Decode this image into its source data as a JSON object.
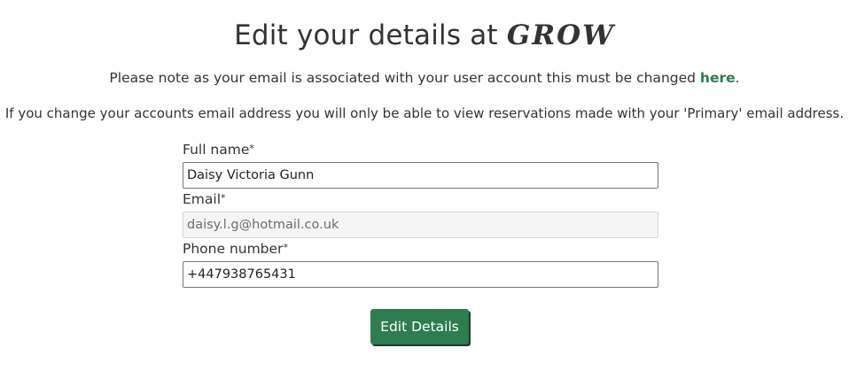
{
  "header": {
    "title_prefix": "Edit your details at",
    "brand": "GROW"
  },
  "notes": {
    "line1_prefix": "Please note as your email is associated with your user account this must be changed ",
    "line1_link": "here",
    "line1_suffix": ".",
    "line2": "If you change your accounts email address you will only be able to view reservations made with your 'Primary' email address."
  },
  "form": {
    "full_name": {
      "label": "Full name",
      "required_mark": "*",
      "value": "Daisy Victoria Gunn"
    },
    "email": {
      "label": "Email",
      "required_mark": "*",
      "value": "daisy.l.g@hotmail.co.uk",
      "disabled": true
    },
    "phone": {
      "label": "Phone number",
      "required_mark": "*",
      "value": "+447938765431"
    },
    "submit_label": "Edit Details"
  },
  "colors": {
    "accent": "#2e7d4f",
    "text": "#333333"
  }
}
